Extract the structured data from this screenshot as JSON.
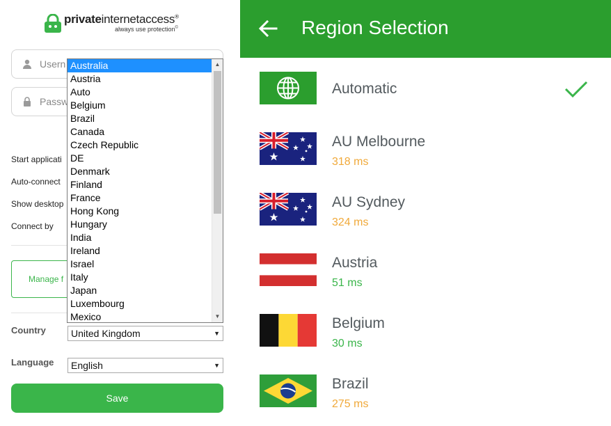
{
  "left_panel": {
    "logo": {
      "name_bold": "private",
      "name_rest": "internetaccess",
      "registered": "®",
      "tagline": "always use protection",
      "tagline_mark": "©"
    },
    "username": {
      "placeholder": "Username",
      "value": "Usern"
    },
    "password": {
      "placeholder": "Password",
      "value": "Passw"
    },
    "options": [
      {
        "label": "Start applicati"
      },
      {
        "label": "Auto-connect"
      },
      {
        "label": "Show desktop"
      },
      {
        "label": "Connect by"
      }
    ],
    "manage_button": {
      "label": "Manage f"
    },
    "country": {
      "label": "Country",
      "value": "United Kingdom"
    },
    "language": {
      "label": "Language",
      "value": "English"
    },
    "save_button": {
      "label": "Save"
    },
    "dropdown": {
      "selected_index": 0,
      "options": [
        "Australia",
        "Austria",
        "Auto",
        "Belgium",
        "Brazil",
        "Canada",
        "Czech Republic",
        "DE",
        "Denmark",
        "Finland",
        "France",
        "Hong Kong",
        "Hungary",
        "India",
        "Ireland",
        "Israel",
        "Italy",
        "Japan",
        "Luxembourg",
        "Mexico"
      ]
    }
  },
  "right_panel": {
    "title": "Region Selection",
    "colors": {
      "appbar": "#2b9e2e",
      "ping_slow": "#f0a93a",
      "ping_fast": "#3ab54a",
      "check": "#3ab54a"
    },
    "regions": [
      {
        "name": "Automatic",
        "ping": "",
        "flag": "globe-icon",
        "selected": true
      },
      {
        "name": "AU Melbourne",
        "ping": "318 ms",
        "ping_status": "slow",
        "flag": "australia-flag"
      },
      {
        "name": "AU Sydney",
        "ping": "324 ms",
        "ping_status": "slow",
        "flag": "australia-flag"
      },
      {
        "name": "Austria",
        "ping": "51 ms",
        "ping_status": "fast",
        "flag": "austria-flag"
      },
      {
        "name": "Belgium",
        "ping": "30 ms",
        "ping_status": "fast",
        "flag": "belgium-flag"
      },
      {
        "name": "Brazil",
        "ping": "275 ms",
        "ping_status": "slow",
        "flag": "brazil-flag"
      }
    ]
  }
}
